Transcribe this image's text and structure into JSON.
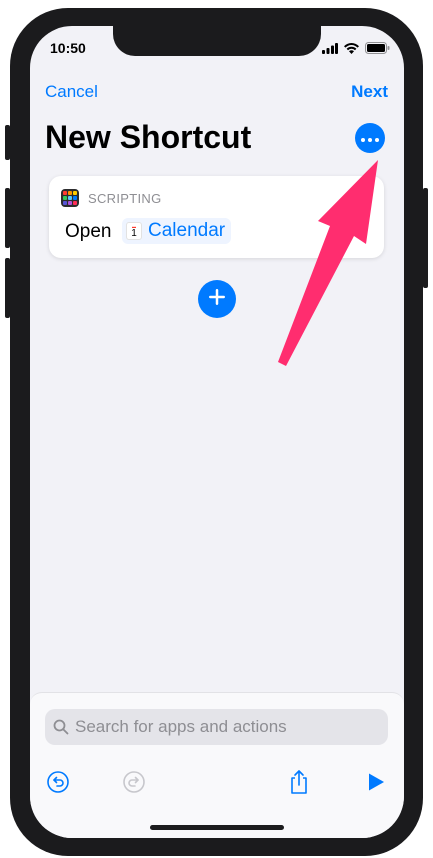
{
  "status_bar": {
    "time": "10:50"
  },
  "nav": {
    "cancel": "Cancel",
    "next": "Next"
  },
  "title": "New Shortcut",
  "action": {
    "category": "SCRIPTING",
    "verb": "Open",
    "app": "Calendar",
    "calendar_icon_day": "1"
  },
  "search": {
    "placeholder": "Search for apps and actions"
  },
  "colors": {
    "accent": "#007aff",
    "annotation_arrow": "#ff2d6f",
    "background": "#f2f2f7"
  },
  "icons": [
    "more-icon",
    "plus-icon",
    "search-icon",
    "undo-icon",
    "redo-icon",
    "share-icon",
    "play-icon",
    "scripting-icon",
    "calendar-icon"
  ]
}
